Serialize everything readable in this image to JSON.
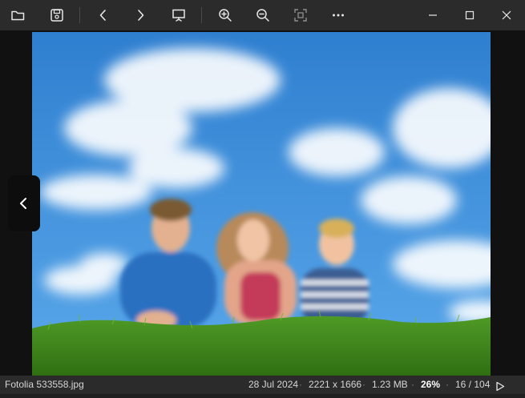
{
  "toolbar": {
    "buttons": [
      {
        "name": "open-folder-icon"
      },
      {
        "name": "save-icon"
      },
      {
        "name": "chevron-left-icon"
      },
      {
        "name": "chevron-right-icon"
      },
      {
        "name": "slideshow-icon"
      },
      {
        "name": "zoom-in-icon"
      },
      {
        "name": "zoom-out-icon"
      },
      {
        "name": "fit-screen-icon"
      },
      {
        "name": "more-icon"
      }
    ],
    "window": [
      "minimize-icon",
      "maximize-icon",
      "close-icon"
    ]
  },
  "photo": {
    "description_colors": {
      "sky": "#3f8fd8",
      "grass": "#3f8a1e"
    }
  },
  "status": {
    "filename": "Fotolia 533558.jpg",
    "date": "28 Jul 2024",
    "dimensions": "2221 x 1666",
    "size": "1.23 MB",
    "zoom": "26%",
    "position": "16 / 104"
  },
  "colors": {
    "toolbar": "#2b2b2b",
    "background": "#111111",
    "accent": "#ffffff"
  }
}
